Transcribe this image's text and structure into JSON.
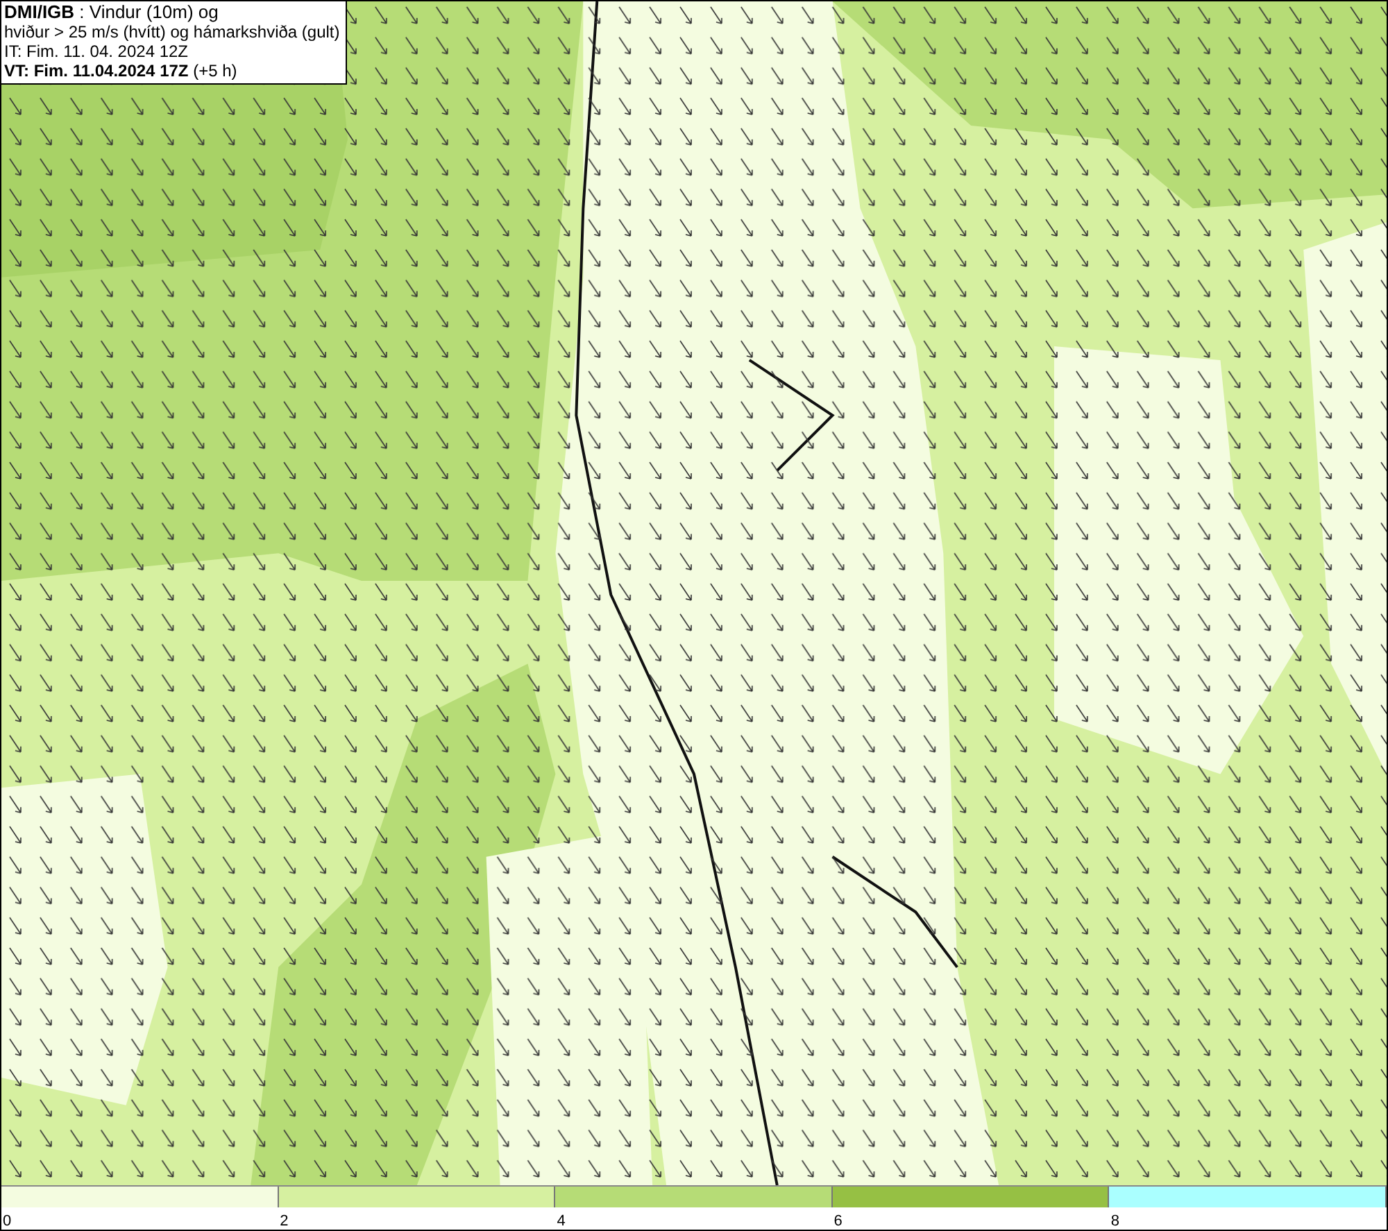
{
  "info_box": {
    "lines": [
      "**DMI/IGB** : Vindur (10m) og",
      "hviður > 25 m/s (hvítt) og hámarkshviða (gult)",
      "IT: Fim. 11. 04. 2024 12Z",
      "**VT: Fim. 11.04.2024 17Z** (+5 h)"
    ]
  },
  "legend": {
    "segments": [
      {
        "color": "#f4fce0"
      },
      {
        "color": "#d6f0a0"
      },
      {
        "color": "#b6dc76"
      },
      {
        "color": "#96c044"
      },
      {
        "color": "#aaffff"
      }
    ],
    "ticks": [
      "0",
      "2",
      "4",
      "6",
      "8"
    ]
  }
}
